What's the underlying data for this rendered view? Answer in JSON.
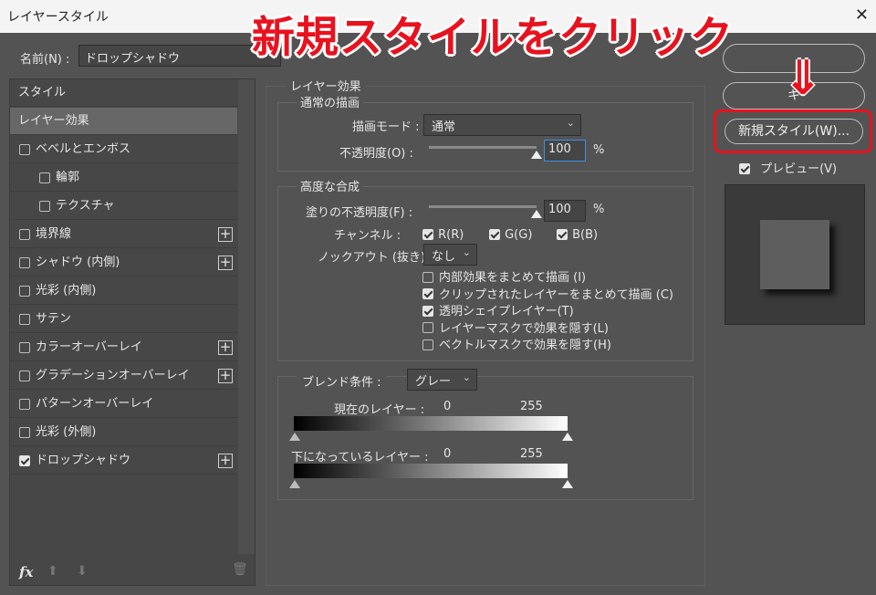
{
  "window": {
    "title": "レイヤースタイル",
    "close": "✕"
  },
  "name_field": {
    "label": "名前(N) :",
    "value": "ドロップシャドウ"
  },
  "sidebar": {
    "items": [
      {
        "label": "スタイル",
        "checkbox": false,
        "plus": false,
        "checked": false,
        "indent": false
      },
      {
        "label": "レイヤー効果",
        "checkbox": false,
        "plus": false,
        "checked": false,
        "indent": false,
        "selected": true
      },
      {
        "label": "ベベルとエンボス",
        "checkbox": true,
        "plus": false,
        "checked": false,
        "indent": false
      },
      {
        "label": "輪郭",
        "checkbox": true,
        "plus": false,
        "checked": false,
        "indent": true
      },
      {
        "label": "テクスチャ",
        "checkbox": true,
        "plus": false,
        "checked": false,
        "indent": true
      },
      {
        "label": "境界線",
        "checkbox": true,
        "plus": true,
        "checked": false,
        "indent": false
      },
      {
        "label": "シャドウ (内側)",
        "checkbox": true,
        "plus": true,
        "checked": false,
        "indent": false
      },
      {
        "label": "光彩 (内側)",
        "checkbox": true,
        "plus": false,
        "checked": false,
        "indent": false
      },
      {
        "label": "サテン",
        "checkbox": true,
        "plus": false,
        "checked": false,
        "indent": false
      },
      {
        "label": "カラーオーバーレイ",
        "checkbox": true,
        "plus": true,
        "checked": false,
        "indent": false
      },
      {
        "label": "グラデーションオーバーレイ",
        "checkbox": true,
        "plus": true,
        "checked": false,
        "indent": false
      },
      {
        "label": "パターンオーバーレイ",
        "checkbox": true,
        "plus": false,
        "checked": false,
        "indent": false
      },
      {
        "label": "光彩 (外側)",
        "checkbox": true,
        "plus": false,
        "checked": false,
        "indent": false
      },
      {
        "label": "ドロップシャドウ",
        "checkbox": true,
        "plus": true,
        "checked": true,
        "indent": false
      }
    ],
    "footer": {
      "fx": "fx",
      "up": "⬆",
      "down": "⬇",
      "trash": "🗑"
    }
  },
  "effects": {
    "title": "レイヤー効果",
    "normal_group": {
      "title": "通常の描画",
      "blend_mode_label": "描画モード :",
      "blend_mode_value": "通常",
      "opacity_label": "不透明度(O) :",
      "opacity_value": "100",
      "opacity_fraction": 1.0,
      "percent": "%"
    },
    "advanced_group": {
      "title": "高度な合成",
      "fill_opacity_label": "塗りの不透明度(F) :",
      "fill_opacity_value": "100",
      "fill_opacity_fraction": 1.0,
      "percent": "%",
      "channels_label": "チャンネル :",
      "channels": [
        "R(R)",
        "G(G)",
        "B(B)"
      ],
      "knockout_label": "ノックアウト (抜き) :",
      "knockout_value": "なし",
      "options": [
        {
          "label": "内部効果をまとめて描画 (I)",
          "checked": false
        },
        {
          "label": "クリップされたレイヤーをまとめて描画 (C)",
          "checked": true
        },
        {
          "label": "透明シェイプレイヤー(T)",
          "checked": true
        },
        {
          "label": "レイヤーマスクで効果を隠す(L)",
          "checked": false
        },
        {
          "label": "ベクトルマスクで効果を隠す(H)",
          "checked": false
        }
      ]
    },
    "blend_if": {
      "label": "ブレンド条件 :",
      "value": "グレー",
      "current_label": "現在のレイヤー :",
      "current_min": "0",
      "current_max": "255",
      "underlying_label": "下になっているレイヤー :",
      "underlying_min": "0",
      "underlying_max": "255"
    }
  },
  "right": {
    "ok_label": "",
    "cancel_label": "キ",
    "new_style_label": "新規スタイル(W)...",
    "preview_label": "プレビュー(V)",
    "preview_checked": true
  },
  "annotation": {
    "banner_text": "新規スタイルをクリック",
    "arrow": "⇓",
    "highlight_color": "#e8121f"
  }
}
